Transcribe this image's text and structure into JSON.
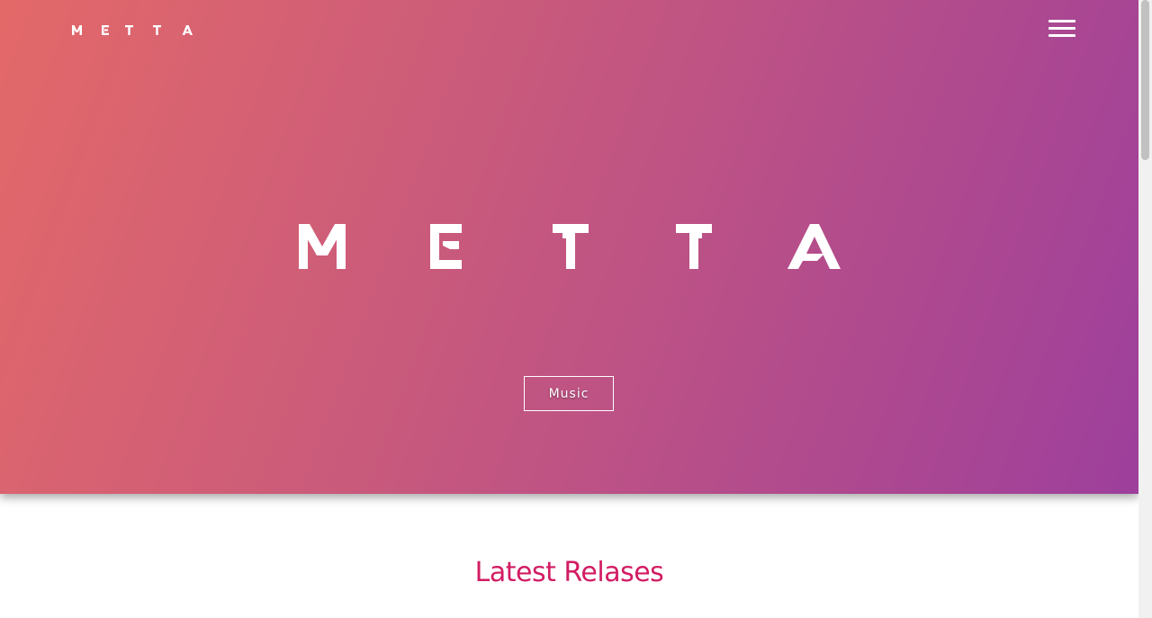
{
  "header": {
    "logo_text": "M E T T A",
    "menu_icon": "hamburger-menu-icon"
  },
  "hero": {
    "logo_text": "M E T T A",
    "cta_label": "Music",
    "gradient_colors": [
      "#e36968",
      "#c95a7c",
      "#b04a8e",
      "#9d3f9c"
    ]
  },
  "latest": {
    "title": "Latest Relases",
    "title_color": "#d21c63"
  }
}
